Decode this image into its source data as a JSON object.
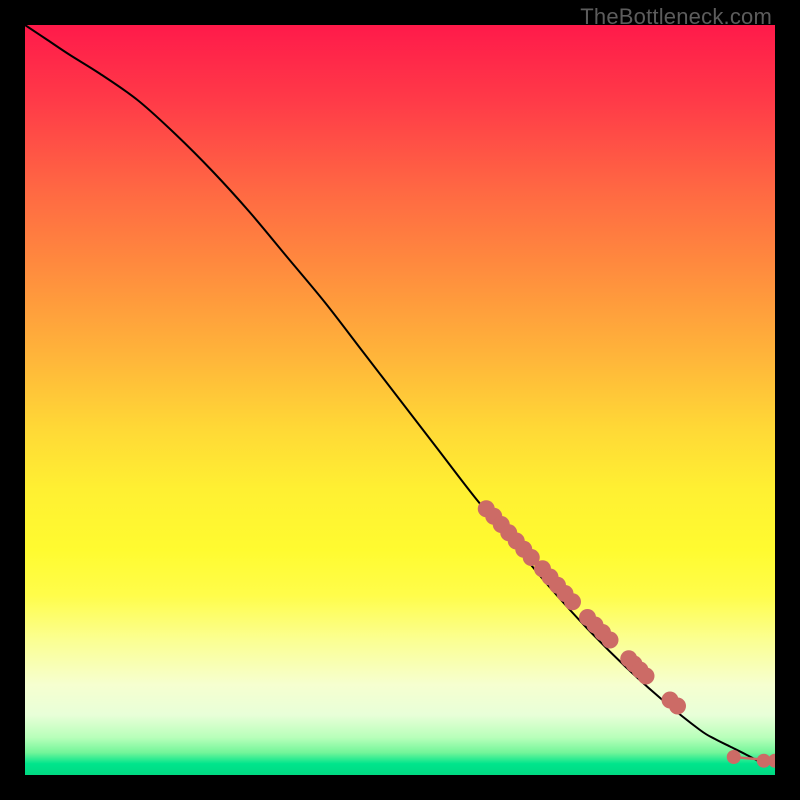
{
  "attribution": "TheBottleneck.com",
  "chart_data": {
    "type": "line",
    "title": "",
    "xlabel": "",
    "ylabel": "",
    "xlim": [
      0,
      100
    ],
    "ylim": [
      0,
      100
    ],
    "grid": false,
    "series": [
      {
        "name": "curve",
        "style": "line",
        "color": "#000000",
        "x": [
          0,
          3,
          6,
          10,
          15,
          20,
          25,
          30,
          35,
          40,
          45,
          50,
          55,
          60,
          65,
          70,
          75,
          80,
          85,
          90,
          92,
          94,
          96,
          97.5,
          99
        ],
        "y": [
          100,
          98,
          96,
          93.5,
          90,
          85.5,
          80.5,
          75,
          69,
          63,
          56.5,
          50,
          43.5,
          37,
          31,
          25,
          19.5,
          14.5,
          10,
          6,
          4.8,
          3.8,
          2.8,
          2,
          1.2
        ]
      },
      {
        "name": "scatter-cluster",
        "style": "scatter",
        "color": "#cc6b66",
        "x": [
          61.5,
          62.5,
          63.5,
          64.5,
          65.5,
          66.5,
          67.5,
          69,
          70,
          71,
          72,
          73,
          75,
          76,
          77,
          78,
          80.5,
          81.2,
          82,
          82.8,
          86,
          87
        ],
        "y": [
          35.5,
          34.5,
          33.4,
          32.3,
          31.2,
          30.1,
          29,
          27.5,
          26.4,
          25.3,
          24.2,
          23.1,
          21,
          20,
          19,
          18,
          15.5,
          14.8,
          14,
          13.2,
          10,
          9.2
        ]
      },
      {
        "name": "tail-points",
        "style": "scatter",
        "color": "#cc6b66",
        "x": [
          94.5,
          98.5,
          100
        ],
        "y": [
          2.4,
          1.9,
          1.9
        ]
      },
      {
        "name": "tail-segment",
        "style": "line",
        "color": "#cc6b66",
        "x": [
          94.5,
          100
        ],
        "y": [
          2.4,
          1.9
        ]
      }
    ]
  }
}
